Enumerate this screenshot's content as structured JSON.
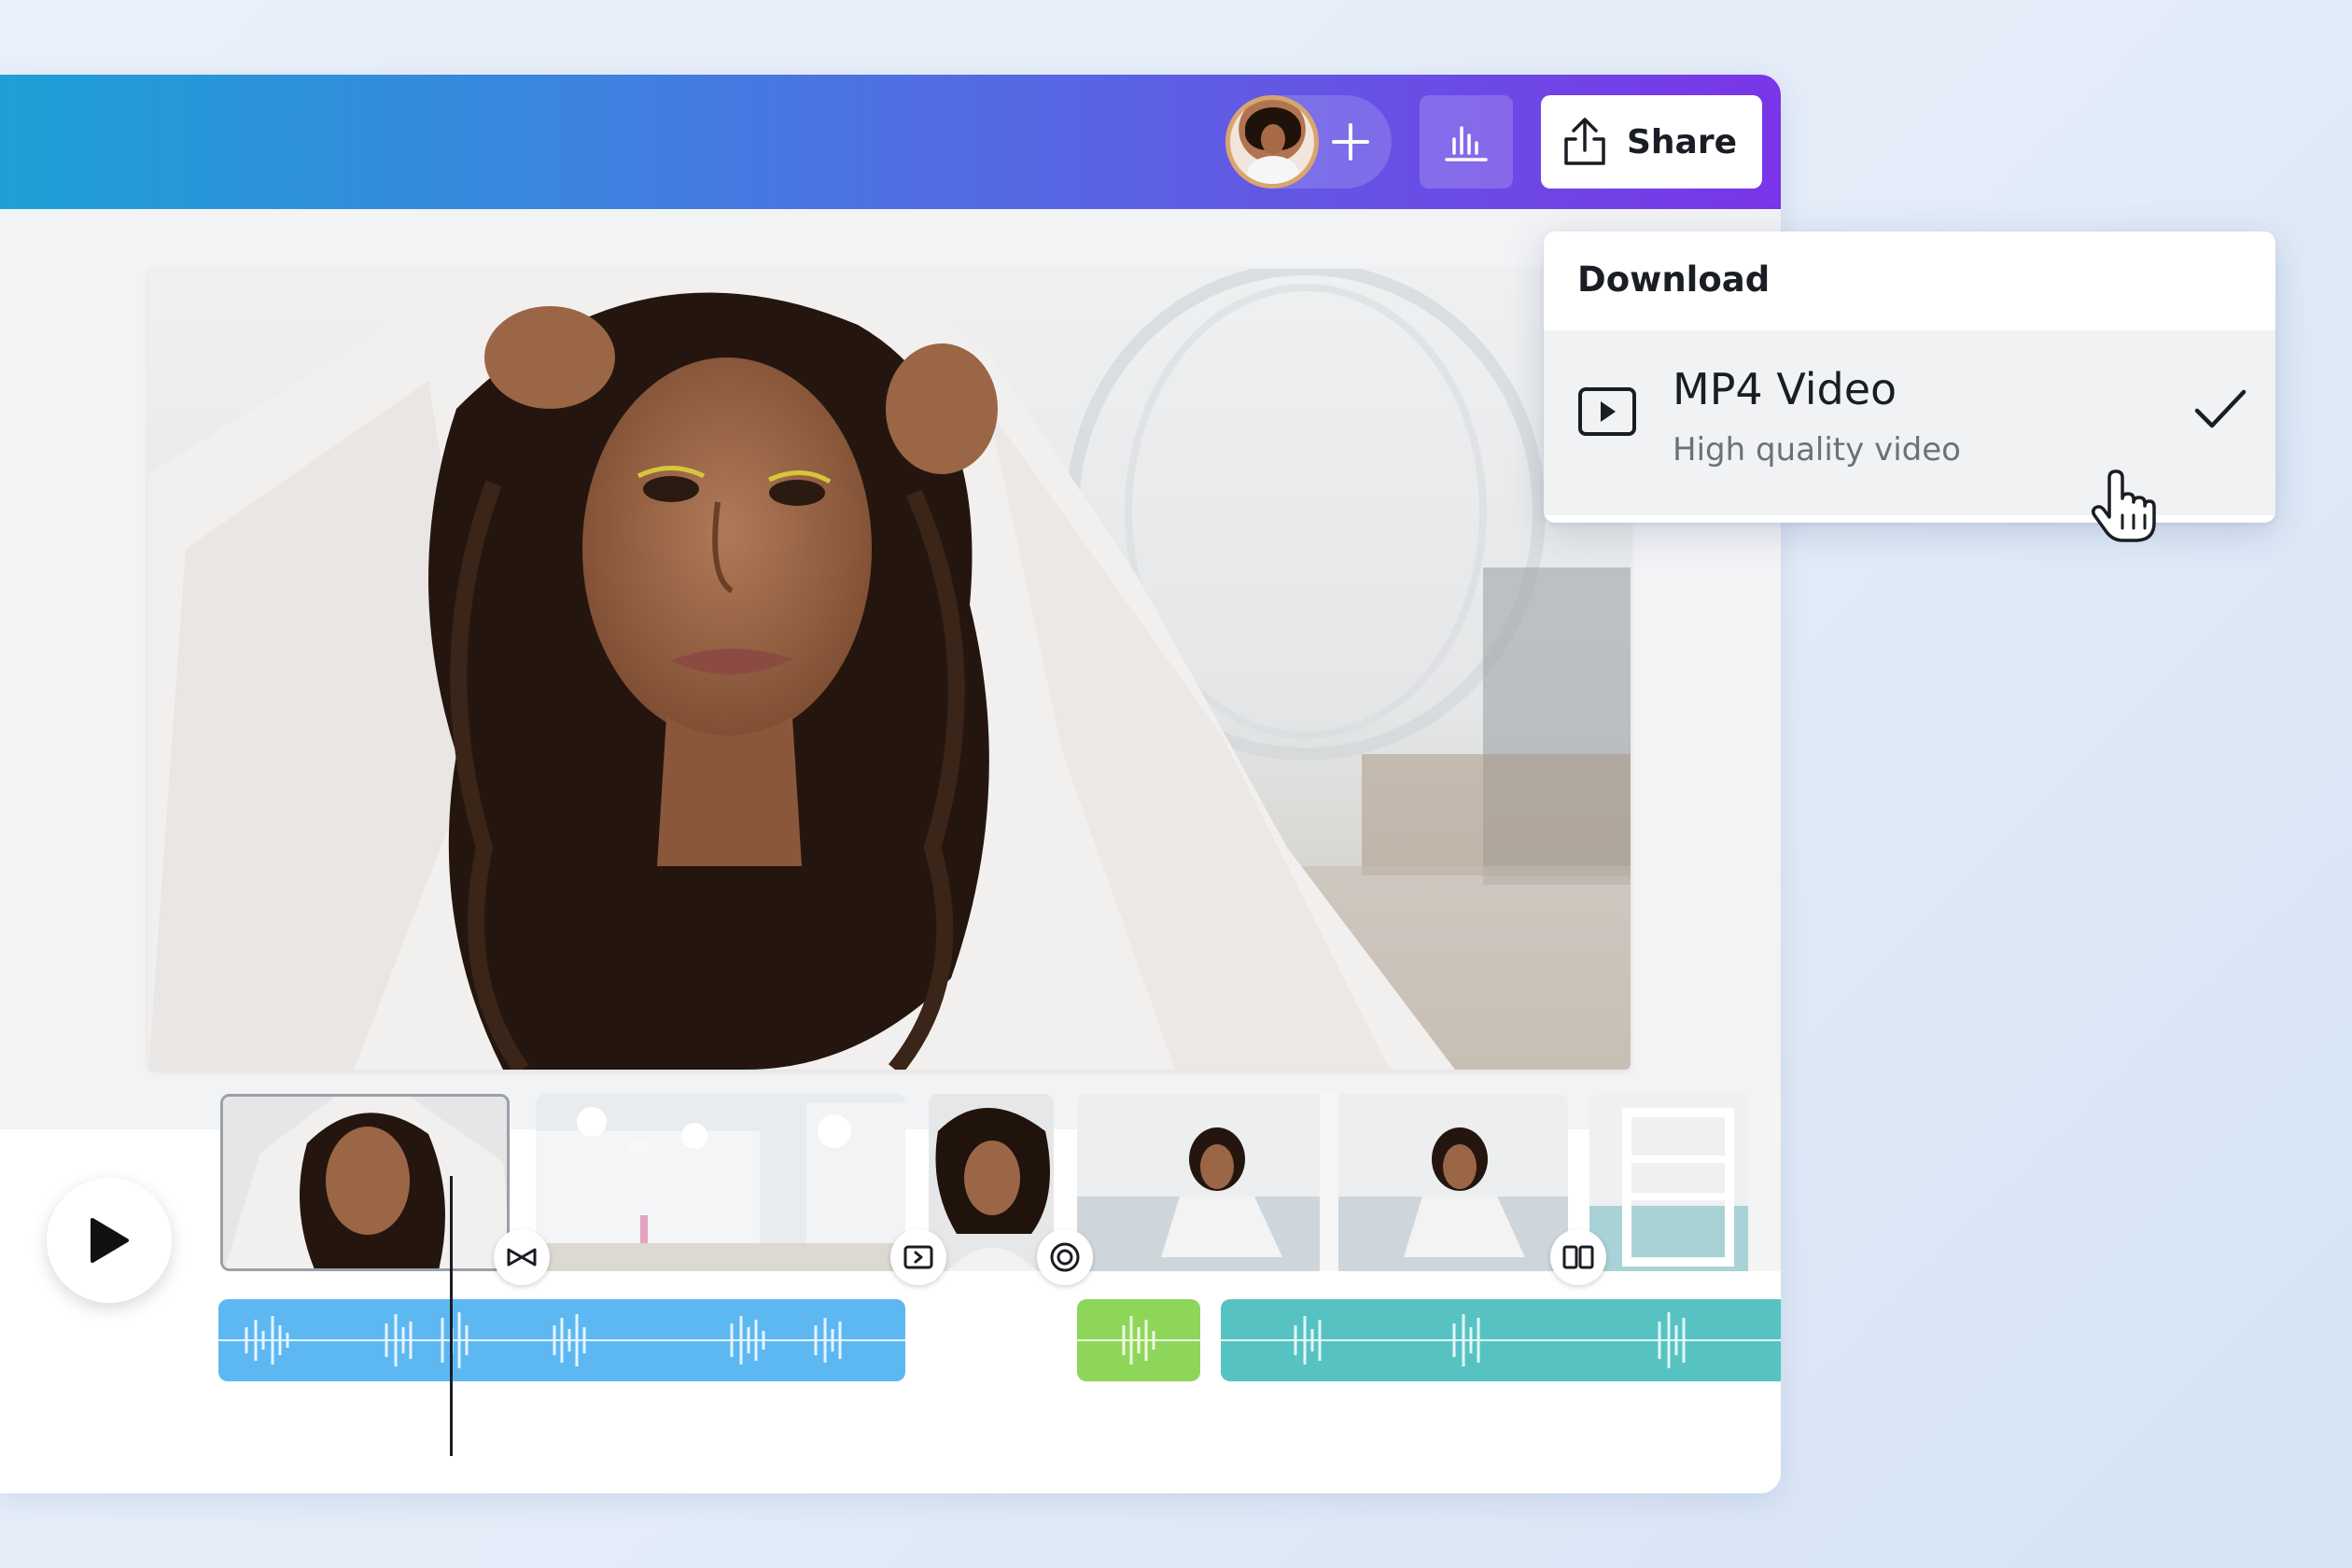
{
  "toolbar": {
    "share_label": "Share",
    "avatar_icon": "user-avatar",
    "add_collaborator_icon": "plus-icon",
    "insights_icon": "bar-chart-icon",
    "share_icon": "upload-icon",
    "gradient_colors": [
      "#1ea0d6",
      "#5a63e3",
      "#7a35e8"
    ]
  },
  "download_menu": {
    "title": "Download",
    "selected_option": {
      "title": "MP4 Video",
      "subtitle": "High quality video",
      "icon": "play-video-icon",
      "checked": true
    }
  },
  "timeline": {
    "play_icon": "play-icon",
    "clips": [
      "clip-1-portrait",
      "clip-2-beach-structures",
      "clip-3-portrait-windblown",
      "clip-4-sitting-pose",
      "clip-5-lifeguard-chair"
    ],
    "transitions": [
      "bowtie-icon",
      "slide-icon",
      "circle-target-icon",
      "split-icon"
    ],
    "audio_tracks": [
      {
        "color": "#5db8f2"
      },
      {
        "color": "#8ed659"
      },
      {
        "color": "#56c3c2"
      }
    ]
  }
}
